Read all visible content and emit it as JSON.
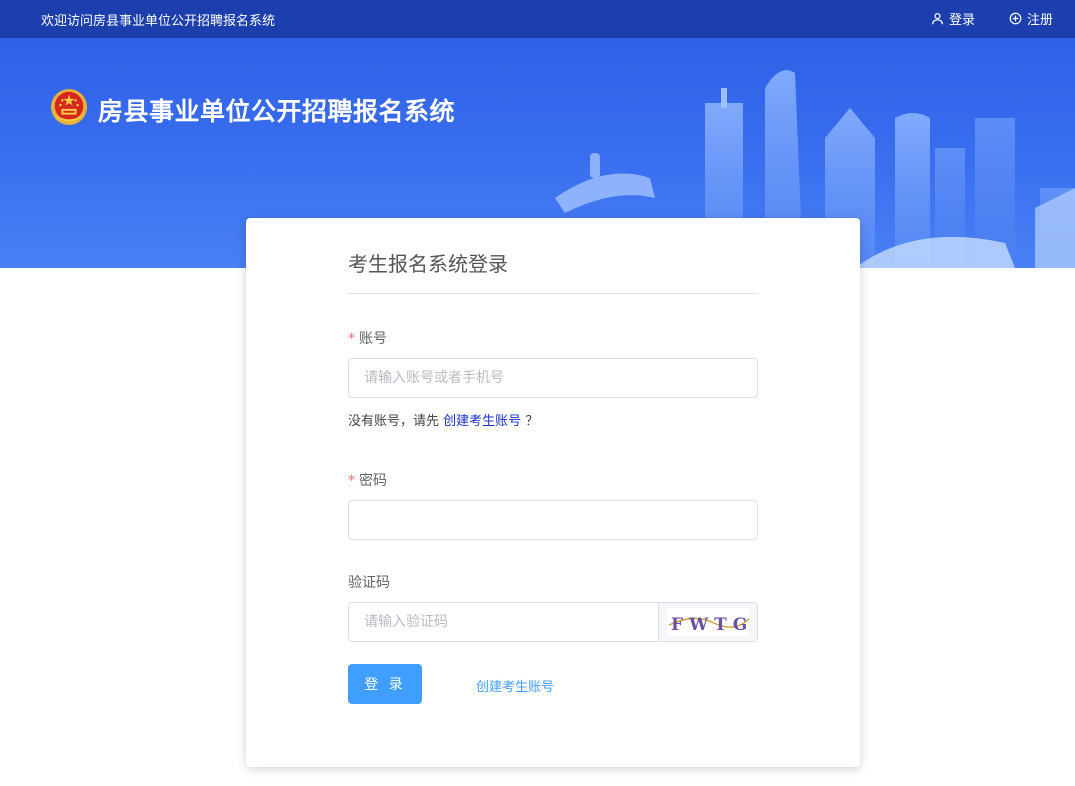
{
  "topbar": {
    "welcome": "欢迎访问房县事业单位公开招聘报名系统",
    "login_label": "登录",
    "register_label": "注册"
  },
  "banner": {
    "site_title": "房县事业单位公开招聘报名系统"
  },
  "form": {
    "title": "考生报名系统登录",
    "account_label": "账号",
    "account_placeholder": "请输入账号或者手机号",
    "hint_prefix": "没有账号，请先",
    "hint_link": "创建考生账号",
    "hint_suffix": "？",
    "password_label": "密码",
    "password_value": "",
    "captcha_label": "验证码",
    "captcha_placeholder": "请输入验证码",
    "captcha_text": "FWTG",
    "login_button": "登 录",
    "create_account_link": "创建考生账号",
    "required_mark": "*"
  },
  "colors": {
    "topbar": "#1d3fae",
    "banner": "#3a6ff0",
    "primary": "#409eff",
    "required": "#f56c6c",
    "link": "#1a34c8"
  }
}
